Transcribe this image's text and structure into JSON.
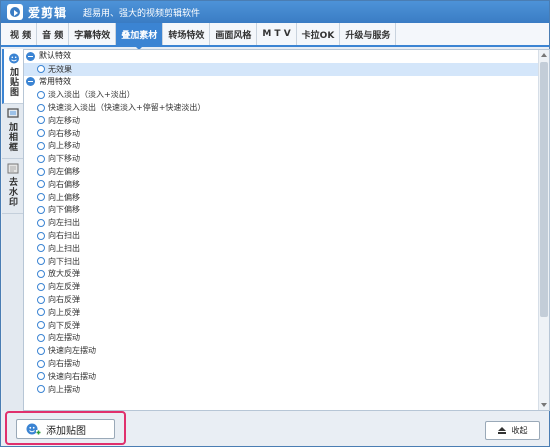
{
  "window": {
    "app_name": "爱剪辑",
    "slogan": "超易用、强大的视频剪辑软件"
  },
  "tabs": [
    {
      "label": "视  频",
      "active": false
    },
    {
      "label": "音  频",
      "active": false
    },
    {
      "label": "字幕特效",
      "active": false
    },
    {
      "label": "叠加素材",
      "active": true
    },
    {
      "label": "转场特效",
      "active": false
    },
    {
      "label": "画面风格",
      "active": false
    },
    {
      "label": "M T V",
      "active": false
    },
    {
      "label": "卡拉OK",
      "active": false
    },
    {
      "label": "升级与服务",
      "active": false
    }
  ],
  "side_tabs": [
    {
      "label": "加贴图",
      "icon": "sticker-icon",
      "active": true
    },
    {
      "label": "加相框",
      "icon": "frame-icon",
      "active": false
    },
    {
      "label": "去水印",
      "icon": "watermark-icon",
      "active": false
    }
  ],
  "groups": [
    {
      "label": "默认特效",
      "items": [
        {
          "label": "无效果",
          "selected": true
        }
      ]
    },
    {
      "label": "常用特效",
      "items": [
        {
          "label": "淡入淡出（淡入+淡出）"
        },
        {
          "label": "快速淡入淡出（快速淡入+停留+快速淡出）"
        },
        {
          "label": "向左移动"
        },
        {
          "label": "向右移动"
        },
        {
          "label": "向上移动"
        },
        {
          "label": "向下移动"
        },
        {
          "label": "向左偏移"
        },
        {
          "label": "向右偏移"
        },
        {
          "label": "向上偏移"
        },
        {
          "label": "向下偏移"
        },
        {
          "label": "向左扫出"
        },
        {
          "label": "向右扫出"
        },
        {
          "label": "向上扫出"
        },
        {
          "label": "向下扫出"
        },
        {
          "label": "放大反弹"
        },
        {
          "label": "向左反弹"
        },
        {
          "label": "向右反弹"
        },
        {
          "label": "向上反弹"
        },
        {
          "label": "向下反弹"
        },
        {
          "label": "向左摆动"
        },
        {
          "label": "快速向左摆动"
        },
        {
          "label": "向右摆动"
        },
        {
          "label": "快速向右摆动"
        },
        {
          "label": "向上摆动"
        }
      ]
    }
  ],
  "bottom": {
    "add_sticker_label": "添加贴图",
    "collapse_label": "收起"
  },
  "colors": {
    "accent": "#3b84d3",
    "title_bar": "#3a7cc4",
    "highlight_border": "#e0306d",
    "selected_row": "#d4e6fa"
  }
}
